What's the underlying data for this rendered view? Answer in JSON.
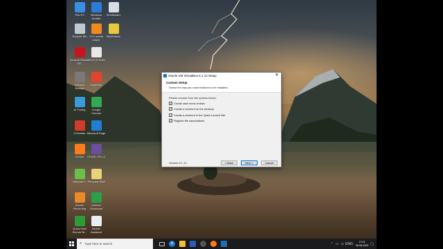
{
  "desktop": {
    "icons": [
      {
        "label": "This PC",
        "color": "#3a8ee6"
      },
      {
        "label": "Windows Update",
        "color": "#2c7bd6"
      },
      {
        "label": "KineMaster",
        "color": "#d8dde6"
      },
      {
        "label": "Recycle Bin",
        "color": "#c0c8d0"
      },
      {
        "label": "VLC media player",
        "color": "#f08a1c"
      },
      {
        "label": "BlueStacks",
        "color": "#e7c83c"
      },
      {
        "label": "Acrobat Reader DC",
        "color": "#c4161c"
      },
      {
        "label": "ASUS Ai Suite",
        "color": "#e8e8e8"
      },
      {
        "label": "ASRock Restart",
        "color": "#7a7a7a"
      },
      {
        "label": "AnyDesk",
        "color": "#e2452b"
      },
      {
        "label": "AI Tuning",
        "color": "#3a9bd9"
      },
      {
        "label": "Google Chrome",
        "color": "#34a853"
      },
      {
        "label": "CCleaner",
        "color": "#d23a2b"
      },
      {
        "label": "Microsoft Edge",
        "color": "#1f7fd6"
      },
      {
        "label": "Firefox",
        "color": "#ff7a1c"
      },
      {
        "label": "CPUID CPU-Z",
        "color": "#6b4ea0"
      },
      {
        "label": "Notepad++",
        "color": "#6cbf4a"
      },
      {
        "label": "Personal Stuff",
        "color": "#e8d27a"
      },
      {
        "label": "Screen Recording",
        "color": "#e8892c"
      },
      {
        "label": "Internet Download",
        "color": "#2aa04a"
      },
      {
        "label": "Quick Heal Secure Br...",
        "color": "#2d9b3a"
      },
      {
        "label": "Mobile Assistant",
        "color": "#e9eef5"
      }
    ]
  },
  "dialog": {
    "title": "Oracle VM VirtualBox 6.1.12 Setup",
    "close_glyph": "✕",
    "header_title": "Custom Setup",
    "header_subtitle": "Select the way you want features to be installed.",
    "prompt": "Please choose from the options below:",
    "options": [
      {
        "label": "Create start menu entries",
        "checked": true
      },
      {
        "label": "Create a shortcut on the desktop",
        "checked": true
      },
      {
        "label": "Create a shortcut in the Quick Launch Bar",
        "checked": true
      },
      {
        "label": "Register file associations",
        "checked": true
      }
    ],
    "check_glyph": "✓",
    "version": "Version 6.1.12",
    "back_label": "< Back",
    "next_label": "Next >",
    "cancel_label": "Cancel"
  },
  "taskbar": {
    "search_placeholder": "Type here to search",
    "language": "ENG",
    "time": "17:21",
    "date": "08-08-2020"
  },
  "colors": {
    "accent": "#0078d7",
    "taskbar_bg": "#1b1b1d"
  }
}
